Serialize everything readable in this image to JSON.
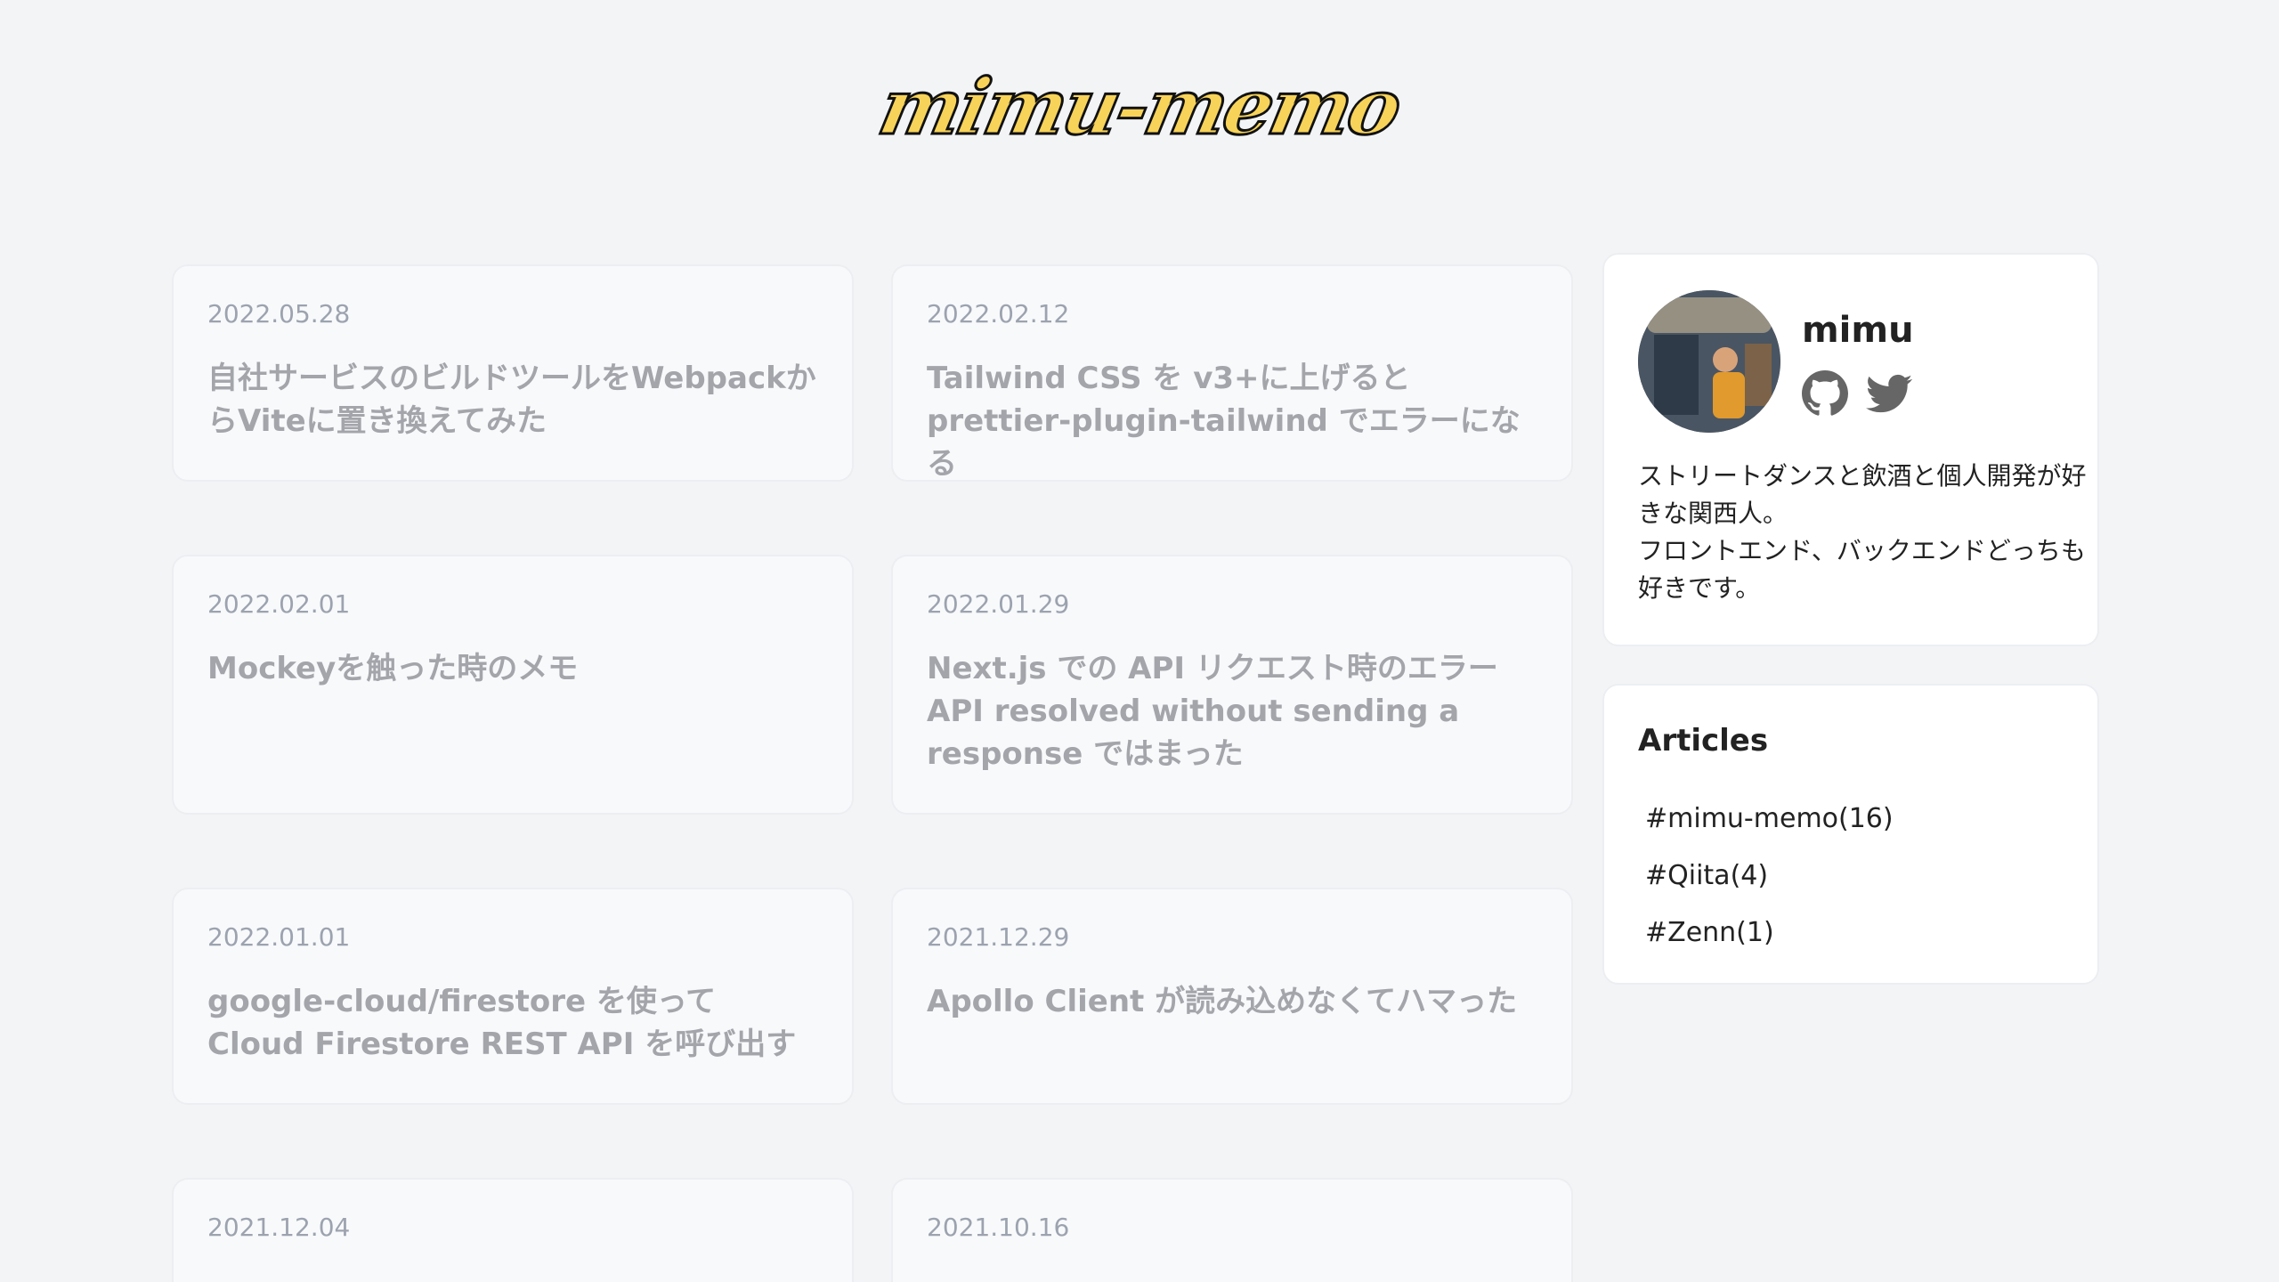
{
  "header": {
    "logo": "mimu-memo"
  },
  "articles": [
    {
      "date": "2022.05.28",
      "title": "自社サービスのビルドツールをWebpackからViteに置き換えてみた"
    },
    {
      "date": "2022.02.12",
      "title": "Tailwind CSS を v3+に上げると prettier-plugin-tailwind でエラーになる"
    },
    {
      "date": "2022.02.01",
      "title": "Mockeyを触った時のメモ"
    },
    {
      "date": "2022.01.29",
      "title": "Next.js での API リクエスト時のエラー API resolved without sending a response ではまった"
    },
    {
      "date": "2022.01.01",
      "title": "google-cloud/firestore を使って Cloud Firestore REST API を呼び出す"
    },
    {
      "date": "2021.12.29",
      "title": "Apollo Client が読み込めなくてハマった"
    },
    {
      "date": "2021.12.04",
      "title": ""
    },
    {
      "date": "2021.10.16",
      "title": ""
    }
  ],
  "profile": {
    "name": "mimu",
    "github_icon": "github-icon",
    "twitter_icon": "twitter-icon",
    "bio_line1": "ストリートダンスと飲酒と個人開発が好きな関西人。",
    "bio_line2": "フロントエンド、バックエンドどっちも好きです。"
  },
  "sidebar_articles": {
    "title": "Articles",
    "tags": [
      "#mimu-memo(16)",
      "#Qiita(4)",
      "#Zenn(1)"
    ]
  },
  "colors": {
    "background": "#f3f4f6",
    "logo_fill": "#f7d35a",
    "logo_stroke": "#111111",
    "card_bg": "#f8f9fb",
    "muted_text": "#9ca3af"
  }
}
